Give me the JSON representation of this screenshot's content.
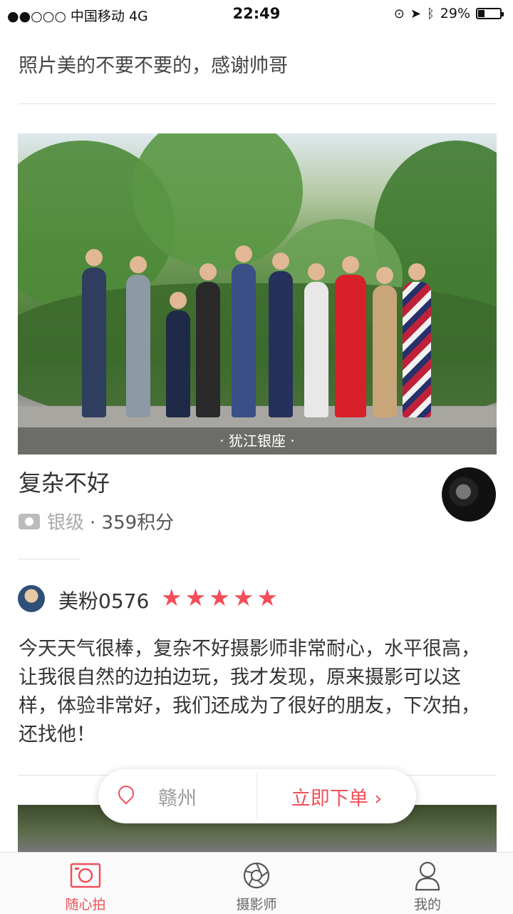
{
  "status_bar": {
    "carrier": "●●○○○ 中国移动  4G",
    "time": "22:49",
    "battery": "29%"
  },
  "top_review_text": "照片美的不要不要的，感谢帅哥",
  "photo": {
    "location_caption": "· 犹江银座 ·"
  },
  "photographer": {
    "name": "复杂不好",
    "level": "银级",
    "points": "· 359积分"
  },
  "review": {
    "user": "美粉0576",
    "stars": "★★★★★",
    "text": "今天天气很棒，复杂不好摄影师非常耐心，水平很高，让我很自然的边拍边玩，我才发现，原来摄影可以这样，体验非常好，我们还成为了很好的朋友，下次拍，还找他！"
  },
  "floating_bar": {
    "city": "赣州",
    "order_label": "立即下单 ›"
  },
  "tabs": [
    {
      "label": "随心拍",
      "icon": "camera-icon",
      "active": true
    },
    {
      "label": "摄影师",
      "icon": "aperture-icon",
      "active": false
    },
    {
      "label": "我的",
      "icon": "person-icon",
      "active": false
    }
  ],
  "colors": {
    "accent": "#f0505a",
    "text": "#333333",
    "muted": "#999999"
  }
}
